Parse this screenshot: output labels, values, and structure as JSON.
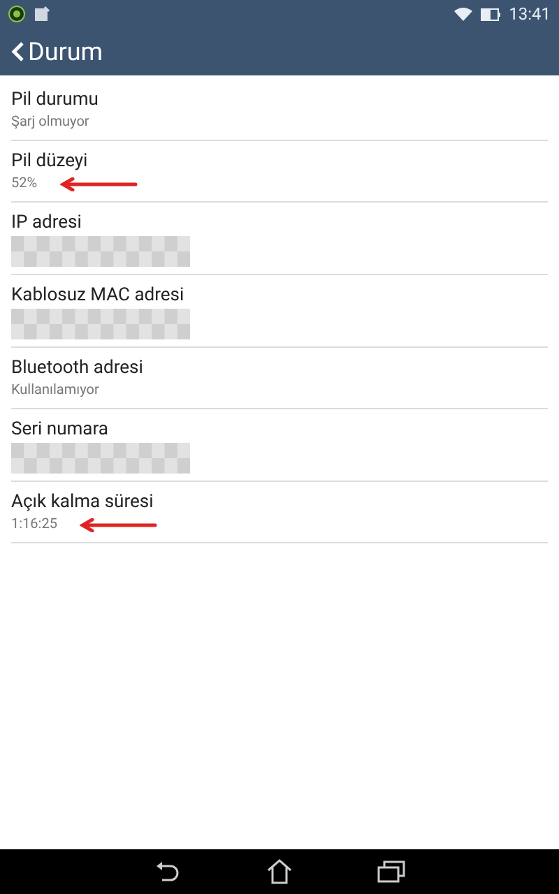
{
  "status_bar": {
    "time": "13:41"
  },
  "action_bar": {
    "title": "Durum"
  },
  "items": [
    {
      "title": "Pil durumu",
      "kind": "text",
      "value": "Şarj olmuyor",
      "marked": false
    },
    {
      "title": "Pil düzeyi",
      "kind": "text",
      "value": "52%",
      "marked": true
    },
    {
      "title": "IP adresi",
      "kind": "redacted",
      "marked": false
    },
    {
      "title": "Kablosuz MAC adresi",
      "kind": "redacted",
      "marked": false
    },
    {
      "title": "Bluetooth adresi",
      "kind": "text",
      "value": "Kullanılamıyor",
      "marked": false
    },
    {
      "title": "Seri numara",
      "kind": "redacted",
      "marked": false
    },
    {
      "title": "Açık kalma süresi",
      "kind": "text",
      "value": "1:16:25",
      "marked": true
    }
  ]
}
